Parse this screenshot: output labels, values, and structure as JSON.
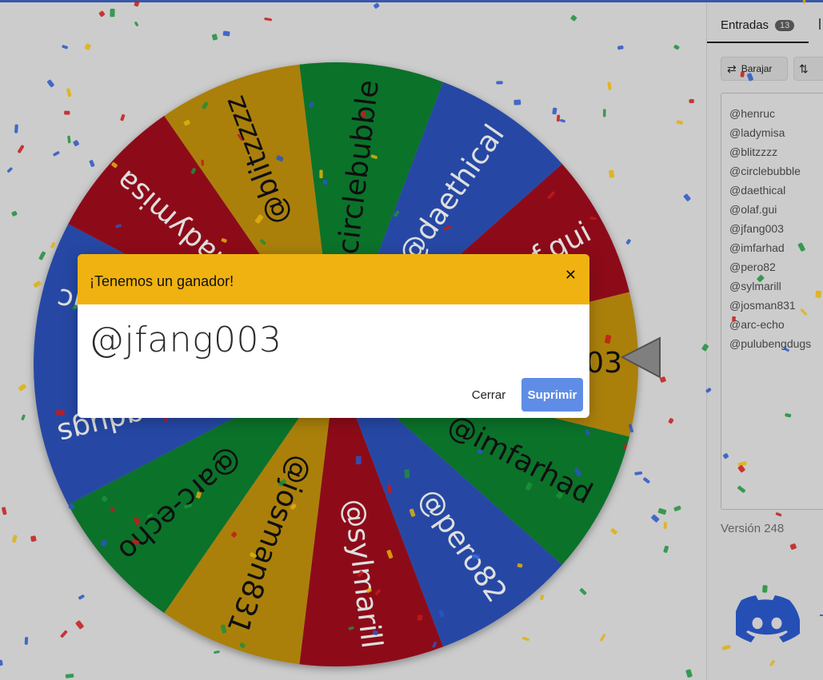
{
  "wheel": {
    "segments": [
      {
        "label": "@henruc",
        "color": "#2a4fb2"
      },
      {
        "label": "@ladymisa",
        "color": "#9a0e1f"
      },
      {
        "label": "@blitzzzz",
        "color": "#b98b0f"
      },
      {
        "label": "@circlebubble",
        "color": "#0e7b2e"
      },
      {
        "label": "@daethical",
        "color": "#2a4fb2"
      },
      {
        "label": "@olaf.gui",
        "color": "#9a0e1f"
      },
      {
        "label": "@jfang003",
        "color": "#b98b0f"
      },
      {
        "label": "@imfarhad",
        "color": "#0e7b2e"
      },
      {
        "label": "@pero82",
        "color": "#2a4fb2"
      },
      {
        "label": "@sylmarill",
        "color": "#9a0e1f"
      },
      {
        "label": "@josman831",
        "color": "#b98b0f"
      },
      {
        "label": "@arc-echo",
        "color": "#0e7b2e"
      },
      {
        "label": "@pulubengdugs",
        "color": "#2a4fb2"
      }
    ]
  },
  "sidebar": {
    "tab_label": "Entradas",
    "tab_count": "13",
    "shuffle_label": "Barajar",
    "shuffle_icon": "shuffle-icon",
    "sort_icon": "sort-icon",
    "entries": [
      "@henruc",
      "@ladymisa",
      "@blitzzzz",
      "@circlebubble",
      "@daethical",
      "@olaf.gui",
      "@jfang003",
      "@imfarhad",
      "@pero82",
      "@sylmarill",
      "@josman831",
      "@arc-echo",
      "@pulubengdugs"
    ],
    "version": "Versión 248",
    "discord_icon": "discord-icon"
  },
  "modal": {
    "title": "¡Tenemos un ganador!",
    "winner": "@jfang003",
    "close_icon": "close-icon",
    "close_button": "Cerrar",
    "delete_button": "Suprimir"
  },
  "colors": {
    "accent": "#f0b211",
    "primary_button": "#5f8de6",
    "discord": "#4a6fbf"
  }
}
